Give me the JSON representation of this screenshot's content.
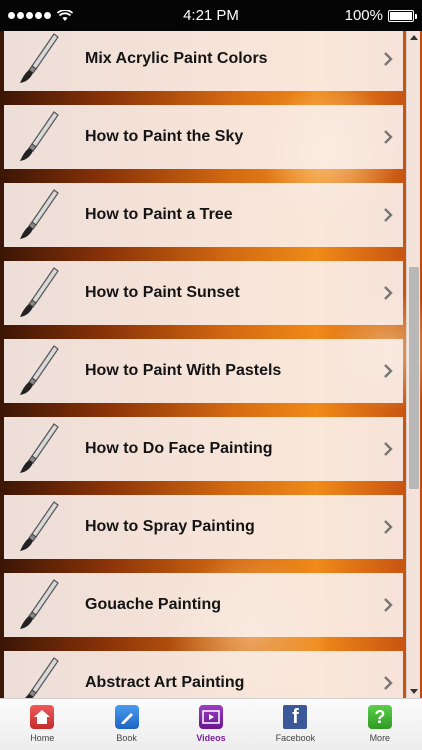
{
  "status_bar": {
    "time": "4:21 PM",
    "battery": "100%"
  },
  "list": {
    "items": [
      {
        "label": "Mix Acrylic Paint Colors"
      },
      {
        "label": "How to Paint the Sky"
      },
      {
        "label": "How to Paint a Tree"
      },
      {
        "label": "How to Paint Sunset"
      },
      {
        "label": "How to Paint With Pastels"
      },
      {
        "label": "How to Do Face Painting"
      },
      {
        "label": "How to Spray Painting"
      },
      {
        "label": "Gouache Painting"
      },
      {
        "label": "Abstract Art Painting"
      }
    ],
    "item_icon": "paintbrush-icon",
    "chevron_icon": "chevron-right-icon"
  },
  "tabbar": {
    "active": "Videos",
    "tabs": [
      {
        "label": "Home",
        "icon": "home-icon",
        "color": "#d83a3a"
      },
      {
        "label": "Book",
        "icon": "book-icon",
        "color": "#2b78d6"
      },
      {
        "label": "Videos",
        "icon": "video-icon",
        "color": "#7a1fa2"
      },
      {
        "label": "Facebook",
        "icon": "facebook-icon",
        "color": "#3b5998"
      },
      {
        "label": "More",
        "icon": "question-icon",
        "color": "#3cae2e"
      }
    ]
  }
}
